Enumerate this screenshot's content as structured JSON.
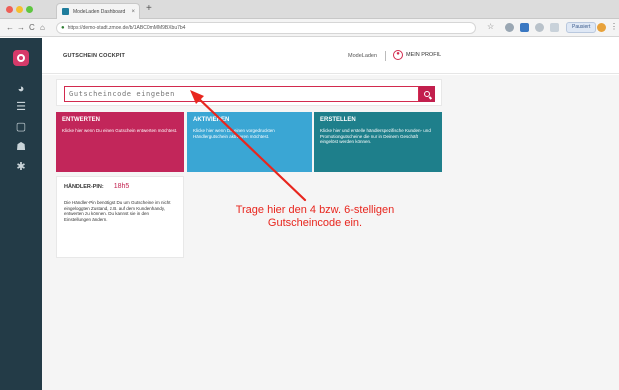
{
  "browser": {
    "tab_title": "ModeLaden Dashboard",
    "tab_close": "×",
    "new_tab": "+",
    "url": "https://demo-stadt.zmoe.de/b/1ABC0mMM9BXbu7b4",
    "pause_label": "Pausiert",
    "nav": {
      "back": "←",
      "forward": "→",
      "reload": "C",
      "home": "⌂"
    },
    "icons": [
      "lock-icon",
      "star-icon",
      "extension-icon",
      "profile-icon",
      "menu-icon"
    ]
  },
  "sidebar": {
    "items": [
      {
        "icon": "logo-icon"
      },
      {
        "icon": "dashboard-icon",
        "glyph": "◕"
      },
      {
        "icon": "list-icon",
        "glyph": "☰"
      },
      {
        "icon": "clipboard-icon",
        "glyph": "▢"
      },
      {
        "icon": "users-icon",
        "glyph": "☗"
      },
      {
        "icon": "gear-icon",
        "glyph": "✱"
      }
    ]
  },
  "header": {
    "title": "GUTSCHEIN COCKPIT",
    "shop": "ModeLaden",
    "profile_label": "MEIN PROFIL"
  },
  "search": {
    "placeholder": "Gutscheincode eingeben"
  },
  "tiles": [
    {
      "title": "ENTWERTEN",
      "text": "Klicke hier wenn Du einen Gutschein entwerten möchtest."
    },
    {
      "title": "AKTIVIEREN",
      "text": "Klicke hier wenn Du einen vorgedruckten Händlergutschein aktivieren möchtest."
    },
    {
      "title": "ERSTELLEN",
      "text": "Klicke hier und erstelle händlerspezifische Kunden- und Promotiongutscheine die nur in Deinem Geschäft eingelöst werden können."
    }
  ],
  "pin": {
    "label": "HÄNDLER-PIN:",
    "value": "18h5",
    "text": "Die Händler-Pin benötigst Du um Gutscheine im nicht eingeloggten Zustand, z.B. auf dem Kundenhandy, entwerten zu können. Du kannst sie in den Einstellungen ändern."
  },
  "annotation": {
    "line1": "Trage hier den 4 bzw. 6-stelligen",
    "line2": "Gutscheincode ein.",
    "color": "#e8261e"
  },
  "colors": {
    "sidebar": "#233b47",
    "accent": "#c21f4d",
    "tile_red": "#c2265a",
    "tile_blue": "#3aa6d4",
    "tile_teal": "#1e7f8b"
  }
}
